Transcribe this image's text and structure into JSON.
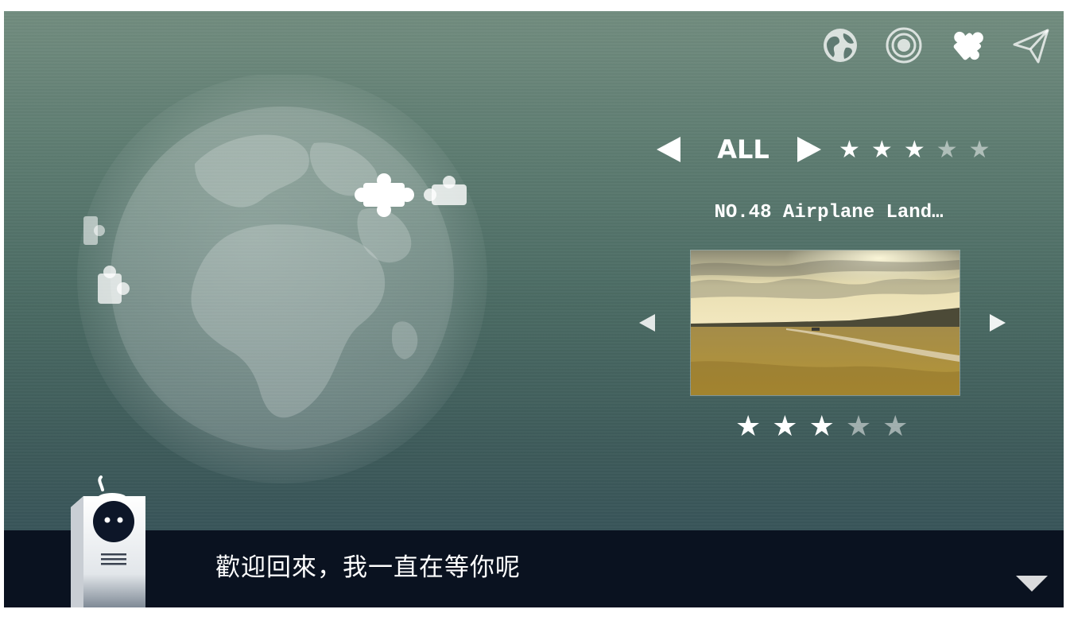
{
  "top_nav": {
    "icons": [
      {
        "name": "globe-icon",
        "active": false
      },
      {
        "name": "target-icon",
        "active": false
      },
      {
        "name": "puzzle-icon",
        "active": true
      },
      {
        "name": "send-icon",
        "active": false
      }
    ]
  },
  "filter": {
    "label": "ALL",
    "difficulty_filled": 3,
    "difficulty_total": 5
  },
  "level": {
    "title": "NO.48 Airplane Land…",
    "stars_filled": 3,
    "stars_total": 5
  },
  "dialog": {
    "text": "歡迎回來，我一直在等你呢"
  },
  "colors": {
    "bg_top": "#728d7f",
    "bg_bottom": "#34505a",
    "dialog_bg": "#0a1220",
    "star_on": "#ffffff",
    "star_off": "#9fb0ad"
  }
}
